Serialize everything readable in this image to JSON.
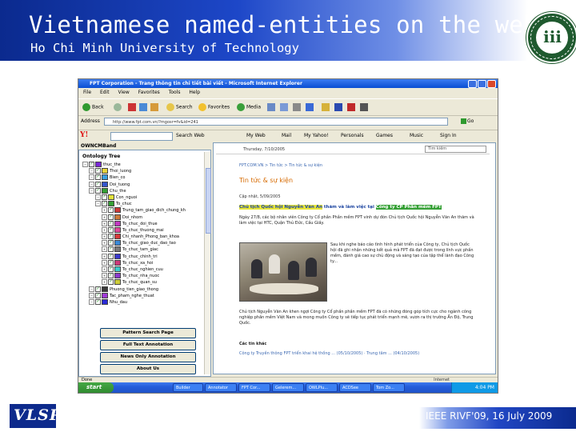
{
  "slide": {
    "title": "Vietnamese named-entities on the web",
    "subtitle": "Ho Chi Minh University of Technology",
    "footer": "IEEE RIVF'09, 16 July 2009",
    "footer_logo": "VLSP",
    "colors": {
      "header_blue": "#0b2a8e",
      "logo_green": "#1f5a2f"
    }
  },
  "browser": {
    "window_title": "FPT Corporation - Trang thông tin chi tiết bài viết - Microsoft Internet Explorer",
    "menu": [
      "File",
      "Edit",
      "View",
      "Favorites",
      "Tools",
      "Help"
    ],
    "toolbar": {
      "back": "Back",
      "search": "Search",
      "favorites": "Favorites",
      "media": "Media"
    },
    "address_label": "Address",
    "address_url": "http://www.fpt.com.vn/?mgosr=fv&id=241",
    "go_label": "Go",
    "yahoo_toolbar": {
      "search_label": "Search Web",
      "items": [
        "My Web",
        "Mail",
        "My Yahoo!",
        "Personals",
        "Games",
        "Music",
        "Sign In"
      ]
    },
    "status_text": "Done",
    "status_zone": "Internet"
  },
  "ontology": {
    "bar_label": "OWNCMBand",
    "panel_title": "Ontology Tree",
    "nodes": [
      {
        "label": "thuc_the",
        "depth": 0,
        "color": "#7a2ad6"
      },
      {
        "label": "Thoi_luong",
        "depth": 1,
        "color": "#e8d33a"
      },
      {
        "label": "Bien_co",
        "depth": 1,
        "color": "#3aa0e0"
      },
      {
        "label": "Doi_tuong",
        "depth": 1,
        "color": "#3555cc"
      },
      {
        "label": "Chu_the",
        "depth": 1,
        "color": "#35a035"
      },
      {
        "label": "Con_nguoi",
        "depth": 2,
        "color": "#e3e33a"
      },
      {
        "label": "To_chuc",
        "depth": 2,
        "color": "#35a035"
      },
      {
        "label": "Trung_tam_giao_dich_chung_kh",
        "depth": 3,
        "color": "#cc3a3a"
      },
      {
        "label": "Doi_nhom",
        "depth": 3,
        "color": "#cc7a3a"
      },
      {
        "label": "To_chuc_doi_thue",
        "depth": 3,
        "color": "#c03ac0"
      },
      {
        "label": "To_chuc_thuong_mai",
        "depth": 3,
        "color": "#e04a9a"
      },
      {
        "label": "Chi_nhanh_Phong_ban_khoa",
        "depth": 3,
        "color": "#d63a3a"
      },
      {
        "label": "To_chuc_giao_duc_dao_tao",
        "depth": 3,
        "color": "#3a8ad6"
      },
      {
        "label": "To_chuc_tam_giac",
        "depth": 3,
        "color": "#7a7a7a"
      },
      {
        "label": "To_chuc_chinh_tri",
        "depth": 3,
        "color": "#3a3acc"
      },
      {
        "label": "To_chuc_xa_hoi",
        "depth": 3,
        "color": "#cc3a7a"
      },
      {
        "label": "To_chuc_nghien_cuu",
        "depth": 3,
        "color": "#3acccc"
      },
      {
        "label": "To_chuc_nha_nuoc",
        "depth": 3,
        "color": "#8a3acc"
      },
      {
        "label": "To_chuc_quan_su",
        "depth": 3,
        "color": "#cccc3a"
      },
      {
        "label": "Phuong_tien_giao_thong",
        "depth": 1,
        "color": "#3a3a3a"
      },
      {
        "label": "Tac_pham_nghe_thuat",
        "depth": 1,
        "color": "#a03ad6"
      },
      {
        "label": "Nhu_dau",
        "depth": 1,
        "color": "#2a2ad6"
      }
    ],
    "buttons": [
      "Pattern Search Page",
      "Full Text Annotation",
      "News Only Annotation",
      "About Us"
    ]
  },
  "webpage": {
    "date": "Thursday, 7/10/2005",
    "search_placeholder": "Tìm kiếm",
    "breadcrumb": "FPT.COM.VN > Tin tức > Tin tức & sự kiện",
    "section_heading": "Tin tức & sự kiện",
    "dateline": "Cập nhật, 5/09/2005",
    "headline_pre": "Chủ tịch Quốc hội Nguyễn Văn An",
    "headline_mid": " thăm và làm việc tại ",
    "headline_org": "Công ty CP Phần mềm FPT",
    "lead": "Ngày 27/8, các bộ nhân viên Công ty Cổ phần Phần mềm FPT vinh dự đón Chủ tịch Quốc hội Nguyễn Văn An thăm và làm việc tại HTC, Quận Thủ Đức, Cầu Giấy.",
    "para1": "Sau khi nghe báo cáo tình hình phát triển của Công ty, Chủ tịch Quốc hội đã ghi nhận những kết quả mà FPT đã đạt được trong lĩnh vực phần mềm, đánh giá cao sự chủ động và sáng tạo của tập thể lãnh đạo Công ty...",
    "para2": "Chủ tịch Nguyễn Văn An khen ngợi Công ty Cổ phần phần mềm FPT đã có những đóng góp tích cực cho ngành công nghiệp phần mềm Việt Nam và mong muốn Công ty sẽ tiếp tục phát triển mạnh mẽ, vươn ra thị trường Ấn Độ, Trung Quốc.",
    "related": "Các tin khác",
    "links": "Công ty Truyền thông FPT triển khai hệ thống ... (05/10/2005) · Trung tâm ... (04/10/2005)"
  },
  "taskbar": {
    "start": "start",
    "tasks": [
      "Builder",
      "Annotator",
      "FPT Cor...",
      "Gelerem...",
      "OWLPlu...",
      "ACDSee",
      "Tom Zo..."
    ],
    "clock": "4:04 PM"
  }
}
